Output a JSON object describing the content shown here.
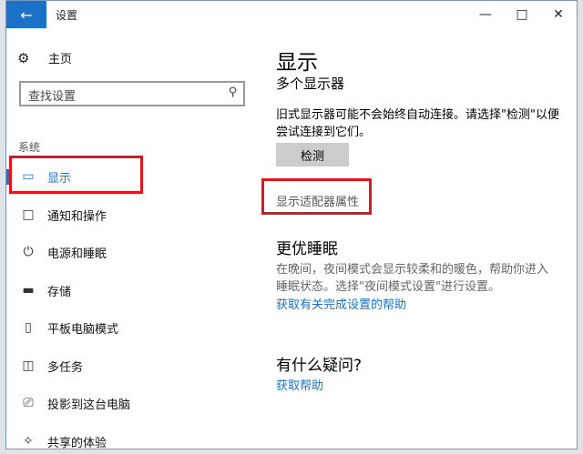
{
  "window": {
    "title": "设置"
  },
  "sidebar": {
    "home_label": "主页",
    "search_placeholder": "查找设置",
    "section_label": "系统",
    "items": [
      {
        "label": "显示",
        "icon": "monitor-icon",
        "active": true
      },
      {
        "label": "通知和操作",
        "icon": "notification-icon"
      },
      {
        "label": "电源和睡眠",
        "icon": "power-icon"
      },
      {
        "label": "存储",
        "icon": "storage-icon"
      },
      {
        "label": "平板电脑模式",
        "icon": "tablet-icon"
      },
      {
        "label": "多任务",
        "icon": "multitask-icon"
      },
      {
        "label": "投影到这台电脑",
        "icon": "project-icon"
      },
      {
        "label": "共享的体验",
        "icon": "share-icon"
      }
    ]
  },
  "main": {
    "title": "显示",
    "subsection_title": "多个显示器",
    "description": "旧式显示器可能不会始终自动连接。请选择\"检测\"以便尝试连接到它们。",
    "detect_button": "检测",
    "adapter_link": "显示适配器属性",
    "night_title": "更优睡眠",
    "night_desc": "在晚间，夜间模式会显示较柔和的暖色，帮助你进入睡眠状态。选择\"夜间模式设置\"进行设置。",
    "night_link": "获取有关完成设置的帮助",
    "question_title": "有什么疑问?",
    "help_link": "获取帮助"
  },
  "colors": {
    "accent": "#1a73c9",
    "highlight_box": "#e3141c"
  }
}
